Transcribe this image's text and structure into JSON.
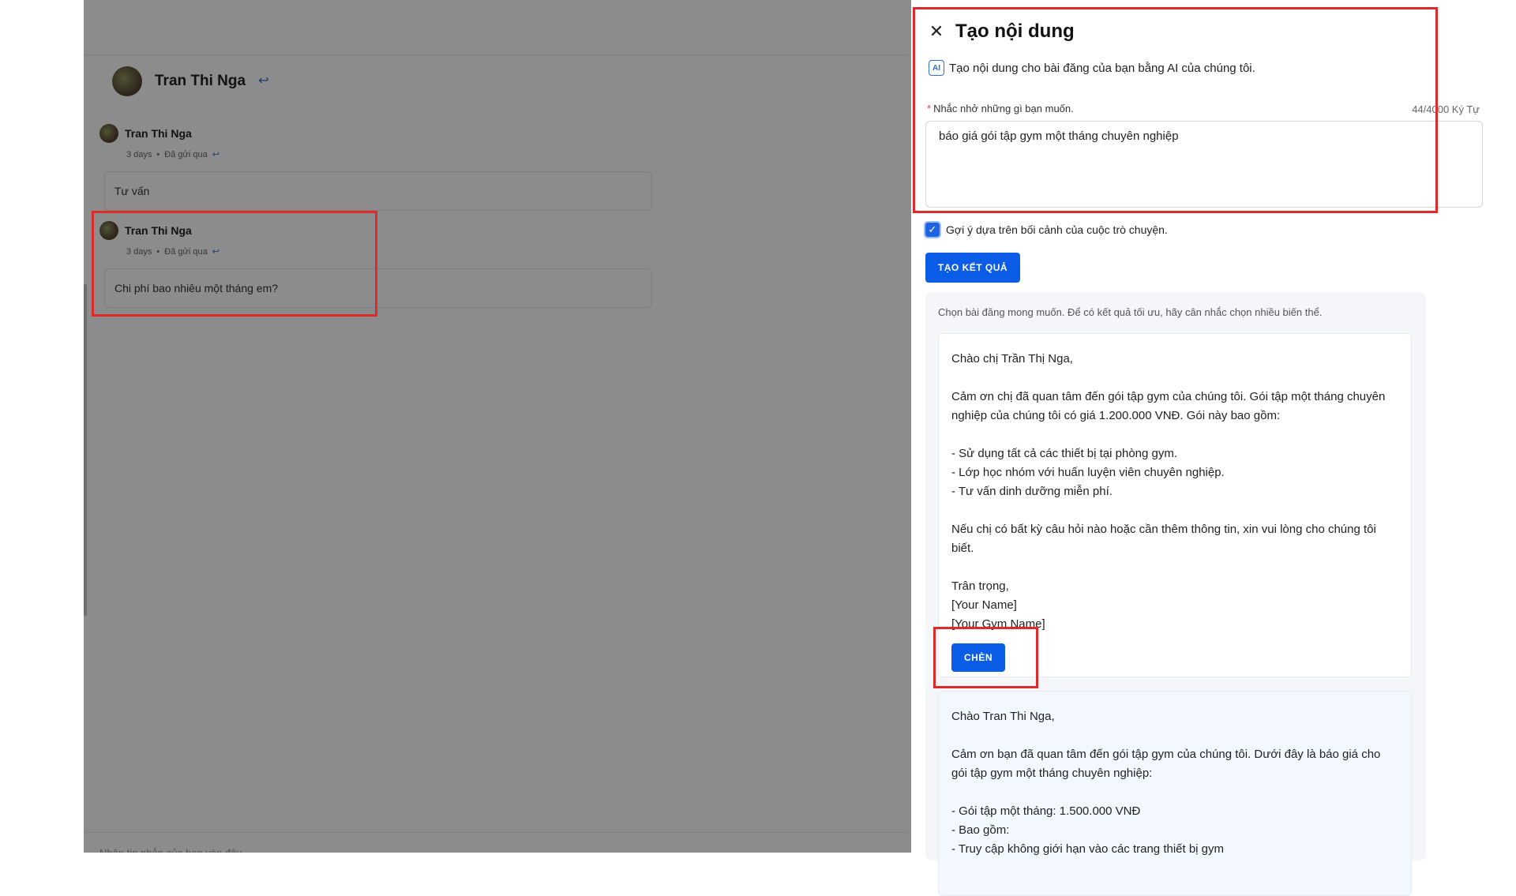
{
  "chat": {
    "contact_name": "Tran Thi Nga",
    "messages": [
      {
        "sender": "Tran Thi Nga",
        "time": "3 days",
        "status": "Đã gửi qua",
        "text": "Tư vấn"
      },
      {
        "sender": "Tran Thi Nga",
        "time": "3 days",
        "status": "Đã gửi qua",
        "text": "Chi phí bao nhiêu một tháng em?"
      }
    ],
    "composer_placeholder": "Nhập tin nhắn của bạn vào đây"
  },
  "drawer": {
    "title": "Tạo nội dung",
    "subtitle": "Tạo nội dung cho bài đăng của bạn bằng AI của chúng tôi.",
    "ai_badge": "AI",
    "prompt_label": "Nhắc nhở những gì bạn muốn.",
    "char_count": "44/4000 Ký Tự",
    "prompt_value": "báo giá gói tập gym một tháng chuyên nghiệp",
    "context_checkbox_label": "Gợi ý dựa trên bối cảnh của cuộc trò chuyện.",
    "context_checked": true,
    "generate_button": "TẠO KẾT QUẢ",
    "results_hint": "Chọn bài đăng mong muốn. Để có kết quả tối ưu, hãy cân nhắc chọn nhiều biến thể.",
    "insert_button": "CHÈN",
    "results": [
      {
        "greeting": "Chào chị Trần Thị Nga,",
        "intro": "Cảm ơn chị đã quan tâm đến gói tập gym của chúng tôi. Gói tập một tháng chuyên nghiệp của chúng tôi có giá 1.200.000 VNĐ. Gói này bao gồm:",
        "items": "- Sử dụng tất cả các thiết bị tại phòng gym.\n- Lớp học nhóm với huấn luyện viên chuyên nghiệp.\n- Tư vấn dinh dưỡng miễn phí.",
        "closing": "Nếu chị có bất kỳ câu hỏi nào hoặc cần thêm thông tin, xin vui lòng cho chúng tôi biết.",
        "signoff": "Trân trọng,\n[Your Name]\n[Your Gym Name]"
      },
      {
        "greeting": "Chào Tran Thi Nga,",
        "intro": "Cảm ơn bạn đã quan tâm đến gói tập gym của chúng tôi. Dưới đây là báo giá cho gói tập gym một tháng chuyên nghiệp:",
        "items": "- Gói tập một tháng: 1.500.000 VNĐ\n- Bao gồm:\n  - Truy cập không giới hạn vào các trang thiết bị gym"
      }
    ]
  }
}
